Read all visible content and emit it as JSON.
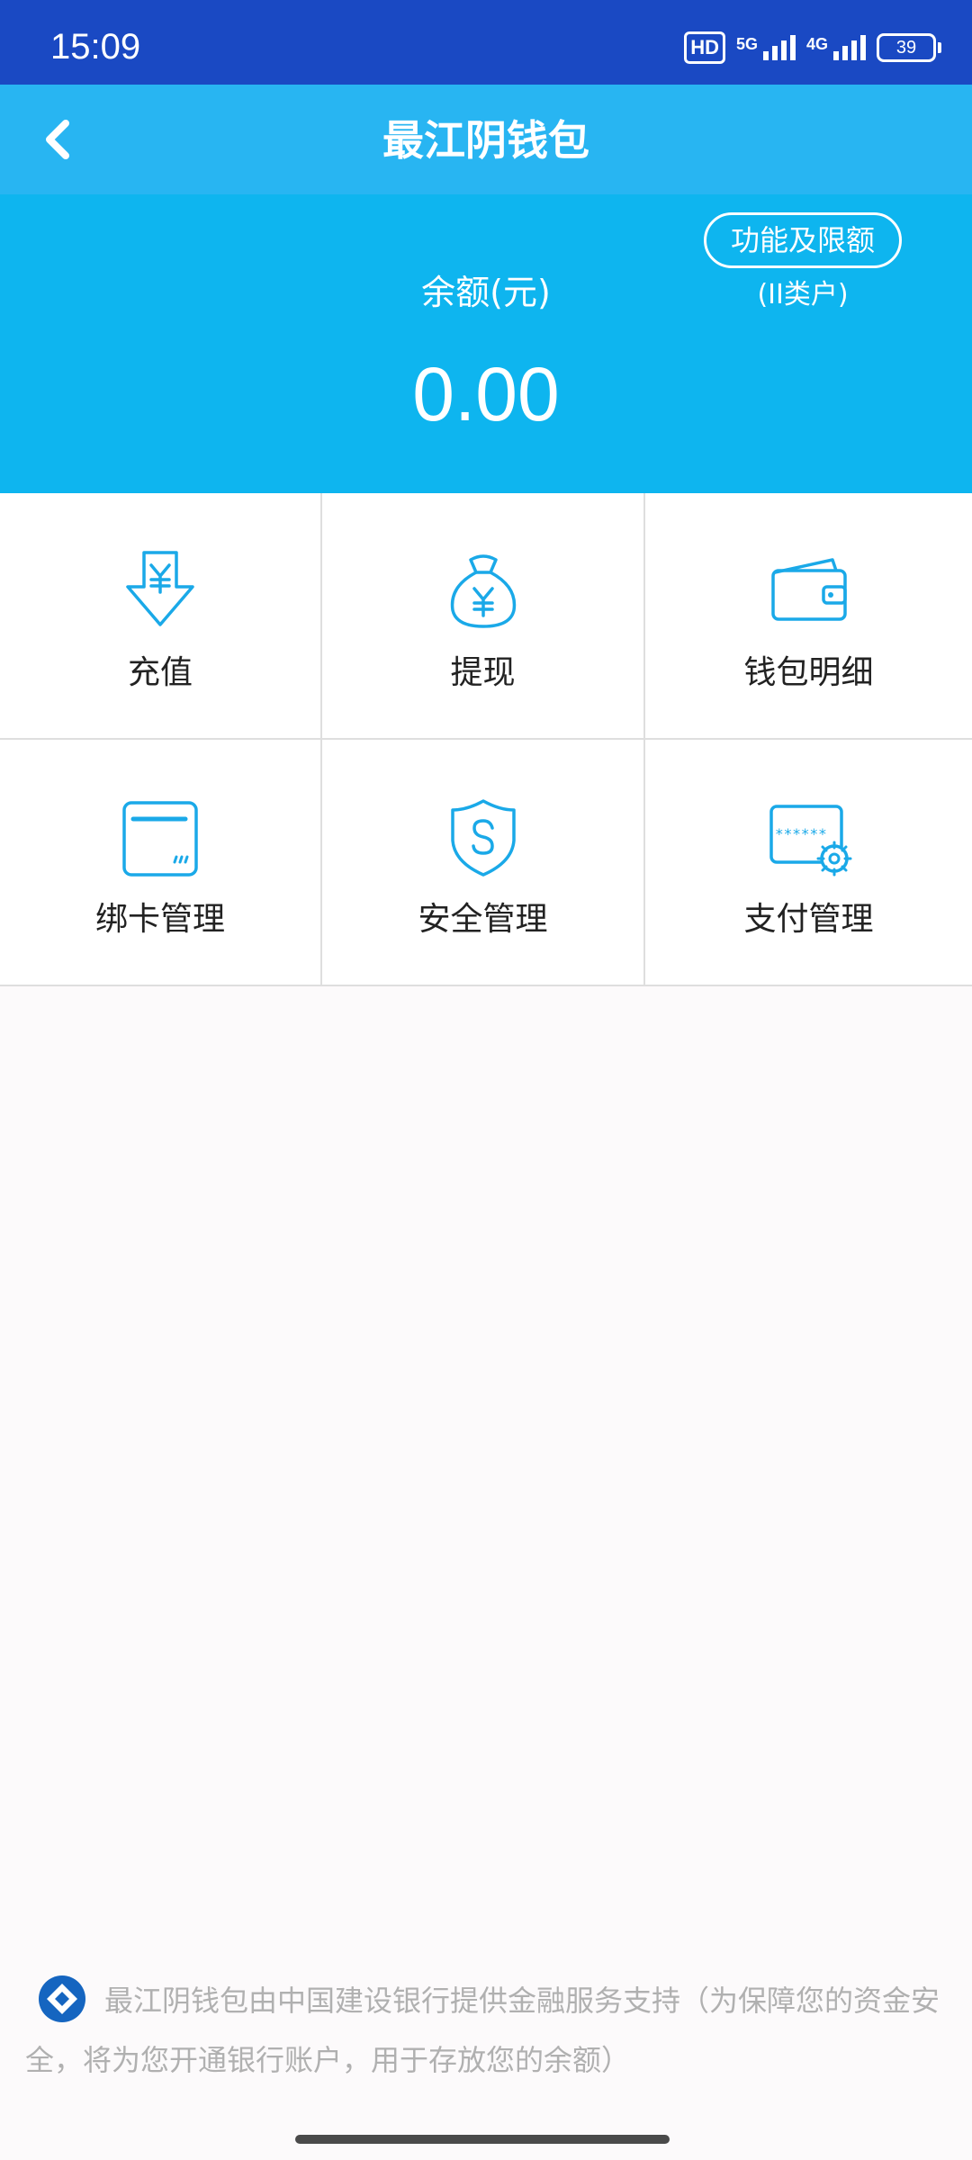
{
  "status_bar": {
    "time": "15:09",
    "hd_label": "HD",
    "network_1": "5G",
    "network_2": "4G",
    "battery": "39"
  },
  "header": {
    "title": "最江阴钱包",
    "back_icon": "chevron-left-icon"
  },
  "balance": {
    "label": "余额(元)",
    "value": "0.00",
    "limit_button": "功能及限额",
    "account_type": "(II类户)"
  },
  "menu": [
    {
      "label": "充值",
      "icon": "recharge-icon"
    },
    {
      "label": "提现",
      "icon": "money-bag-icon"
    },
    {
      "label": "钱包明细",
      "icon": "wallet-icon"
    },
    {
      "label": "绑卡管理",
      "icon": "card-icon"
    },
    {
      "label": "安全管理",
      "icon": "shield-icon"
    },
    {
      "label": "支付管理",
      "icon": "password-settings-icon"
    }
  ],
  "footer": {
    "note": "最江阴钱包由中国建设银行提供金融服务支持（为保障您的资金安全，将为您开通银行账户，用于存放您的余额）",
    "logo_icon": "ccb-logo-icon"
  },
  "colors": {
    "status_bar": "#1a49c3",
    "nav_bar": "#28b5f2",
    "balance_panel": "#0eb5ef",
    "icon_accent": "#1aa9e8"
  }
}
